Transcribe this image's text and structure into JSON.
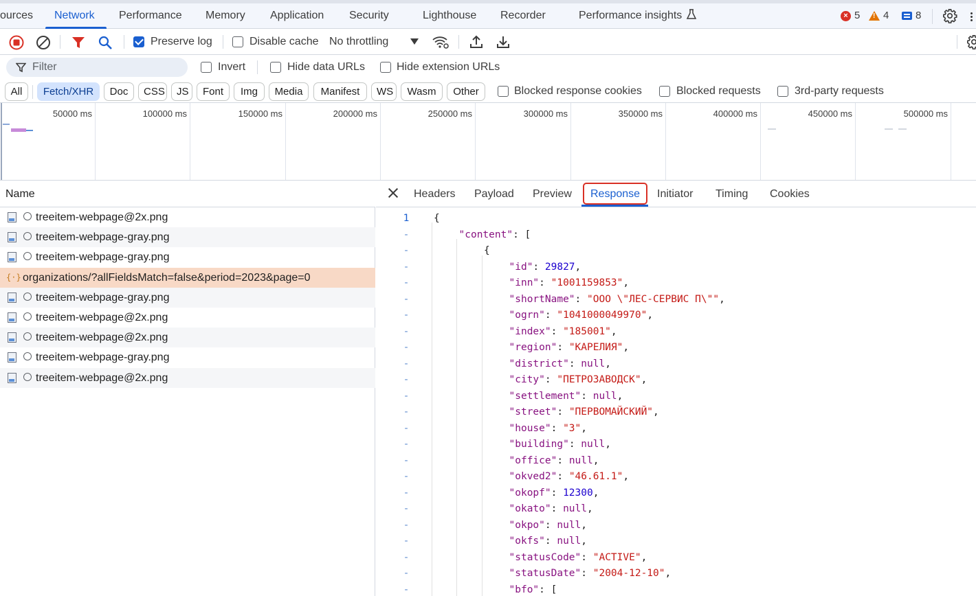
{
  "top_tabs": [
    {
      "label": "ources",
      "active": false
    },
    {
      "label": "Network",
      "active": true
    },
    {
      "label": "Performance",
      "active": false
    },
    {
      "label": "Memory",
      "active": false
    },
    {
      "label": "Application",
      "active": false
    },
    {
      "label": "Security",
      "active": false
    },
    {
      "label": "Lighthouse",
      "active": false
    },
    {
      "label": "Recorder",
      "active": false
    },
    {
      "label": "Performance insights",
      "active": false
    }
  ],
  "counters": {
    "errors": "5",
    "warnings": "4",
    "messages": "8"
  },
  "toolbar": {
    "preserve_log": "Preserve log",
    "preserve_log_checked": true,
    "disable_cache": "Disable cache",
    "disable_cache_checked": false,
    "throttling": "No throttling"
  },
  "filter": {
    "placeholder": "Filter",
    "invert": "Invert",
    "hide_data_urls": "Hide data URLs",
    "hide_extension_urls": "Hide extension URLs"
  },
  "type_filters": [
    "All",
    "Fetch/XHR",
    "Doc",
    "CSS",
    "JS",
    "Font",
    "Img",
    "Media",
    "Manifest",
    "WS",
    "Wasm",
    "Other"
  ],
  "active_type": "Fetch/XHR",
  "extra_filters": [
    "Blocked response cookies",
    "Blocked requests",
    "3rd-party requests"
  ],
  "timeline_ticks": [
    "50000 ms",
    "100000 ms",
    "150000 ms",
    "200000 ms",
    "250000 ms",
    "300000 ms",
    "350000 ms",
    "400000 ms",
    "450000 ms",
    "500000 ms"
  ],
  "request_list": {
    "header": "Name",
    "rows": [
      {
        "name": "treeitem-webpage@2x.png",
        "kind": "img"
      },
      {
        "name": "treeitem-webpage-gray.png",
        "kind": "img"
      },
      {
        "name": "treeitem-webpage-gray.png",
        "kind": "img"
      },
      {
        "name": "organizations/?allFieldsMatch=false&period=2023&page=0",
        "kind": "json",
        "selected": true
      },
      {
        "name": "treeitem-webpage-gray.png",
        "kind": "img"
      },
      {
        "name": "treeitem-webpage@2x.png",
        "kind": "img"
      },
      {
        "name": "treeitem-webpage@2x.png",
        "kind": "img"
      },
      {
        "name": "treeitem-webpage-gray.png",
        "kind": "img"
      },
      {
        "name": "treeitem-webpage@2x.png",
        "kind": "img"
      }
    ]
  },
  "detail_tabs": [
    "Headers",
    "Payload",
    "Preview",
    "Response",
    "Initiator",
    "Timing",
    "Cookies"
  ],
  "active_detail_tab": "Response",
  "response_lines": [
    {
      "ln": "1",
      "indent": 0,
      "key": "",
      "value": "{",
      "vtype": "punct"
    },
    {
      "ln": "-",
      "indent": 1,
      "key": "\"content\"",
      "value": "[",
      "vtype": "punct"
    },
    {
      "ln": "-",
      "indent": 2,
      "key": "",
      "value": "{",
      "vtype": "punct"
    },
    {
      "ln": "-",
      "indent": 3,
      "key": "\"id\"",
      "value": "29827",
      "vtype": "num",
      "comma": true
    },
    {
      "ln": "-",
      "indent": 3,
      "key": "\"inn\"",
      "value": "\"1001159853\"",
      "vtype": "str",
      "comma": true
    },
    {
      "ln": "-",
      "indent": 3,
      "key": "\"shortName\"",
      "value": "\"ООО \\\"ЛЕС-СЕРВИС П\\\"\"",
      "vtype": "str",
      "comma": true
    },
    {
      "ln": "-",
      "indent": 3,
      "key": "\"ogrn\"",
      "value": "\"1041000049970\"",
      "vtype": "str",
      "comma": true
    },
    {
      "ln": "-",
      "indent": 3,
      "key": "\"index\"",
      "value": "\"185001\"",
      "vtype": "str",
      "comma": true
    },
    {
      "ln": "-",
      "indent": 3,
      "key": "\"region\"",
      "value": "\"КАРЕЛИЯ\"",
      "vtype": "str",
      "comma": true
    },
    {
      "ln": "-",
      "indent": 3,
      "key": "\"district\"",
      "value": "null",
      "vtype": "null",
      "comma": true
    },
    {
      "ln": "-",
      "indent": 3,
      "key": "\"city\"",
      "value": "\"ПЕТРОЗАВОДСК\"",
      "vtype": "str",
      "comma": true
    },
    {
      "ln": "-",
      "indent": 3,
      "key": "\"settlement\"",
      "value": "null",
      "vtype": "null",
      "comma": true
    },
    {
      "ln": "-",
      "indent": 3,
      "key": "\"street\"",
      "value": "\"ПЕРВОМАЙСКИЙ\"",
      "vtype": "str",
      "comma": true
    },
    {
      "ln": "-",
      "indent": 3,
      "key": "\"house\"",
      "value": "\"3\"",
      "vtype": "str",
      "comma": true
    },
    {
      "ln": "-",
      "indent": 3,
      "key": "\"building\"",
      "value": "null",
      "vtype": "null",
      "comma": true
    },
    {
      "ln": "-",
      "indent": 3,
      "key": "\"office\"",
      "value": "null",
      "vtype": "null",
      "comma": true
    },
    {
      "ln": "-",
      "indent": 3,
      "key": "\"okved2\"",
      "value": "\"46.61.1\"",
      "vtype": "str",
      "comma": true
    },
    {
      "ln": "-",
      "indent": 3,
      "key": "\"okopf\"",
      "value": "12300",
      "vtype": "num",
      "comma": true
    },
    {
      "ln": "-",
      "indent": 3,
      "key": "\"okato\"",
      "value": "null",
      "vtype": "null",
      "comma": true
    },
    {
      "ln": "-",
      "indent": 3,
      "key": "\"okpo\"",
      "value": "null",
      "vtype": "null",
      "comma": true
    },
    {
      "ln": "-",
      "indent": 3,
      "key": "\"okfs\"",
      "value": "null",
      "vtype": "null",
      "comma": true
    },
    {
      "ln": "-",
      "indent": 3,
      "key": "\"statusCode\"",
      "value": "\"ACTIVE\"",
      "vtype": "str",
      "comma": true
    },
    {
      "ln": "-",
      "indent": 3,
      "key": "\"statusDate\"",
      "value": "\"2004-12-10\"",
      "vtype": "str",
      "comma": true
    },
    {
      "ln": "-",
      "indent": 3,
      "key": "\"bfo\"",
      "value": "[",
      "vtype": "punct"
    }
  ],
  "colors": {
    "accent": "#1a5fd0",
    "selected_row": "#f8d9c6",
    "error": "#d93025",
    "warning": "#e37400",
    "json_key": "#881280",
    "json_string": "#c41a16",
    "json_number": "#1c00cf"
  },
  "icons": {
    "record": "stop-recording-icon",
    "clear": "clear-icon",
    "filter": "filter-funnel-icon",
    "search": "search-icon",
    "network_conditions": "wifi-settings-icon",
    "import": "upload-icon",
    "export": "download-icon",
    "settings": "gear-icon"
  }
}
